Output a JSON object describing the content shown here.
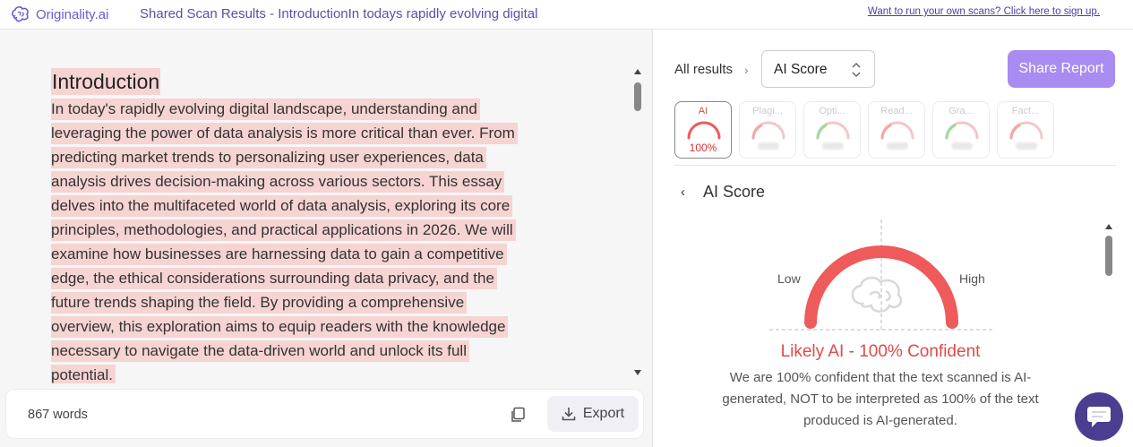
{
  "header": {
    "brand": "Originality.ai",
    "shared_title": "Shared Scan Results - IntroductionIn todays rapidly evolving digital",
    "signup_link": "Want to run your own scans? Click here to sign up."
  },
  "document": {
    "title": "Introduction",
    "lines": [
      "In today's rapidly evolving digital landscape, understanding and",
      "leveraging the power of data analysis is more critical than ever. From",
      "predicting market trends to personalizing user experiences, data",
      "analysis drives decision-making across various sectors. This essay",
      "delves into the multifaceted world of data analysis, exploring its core",
      "principles, methodologies, and practical applications in 2026. We will",
      "examine how businesses are harnessing data to gain a competitive",
      "edge, the ethical considerations surrounding data privacy, and the",
      "future trends shaping the field. By providing a comprehensive",
      "overview, this exploration aims to equip readers with the knowledge",
      "necessary to navigate the data-driven world and unlock its full",
      "potential."
    ],
    "highlight_color": "#f6d4d2"
  },
  "footer": {
    "word_count": "867 words",
    "export_label": "Export"
  },
  "results": {
    "breadcrumb": "All results",
    "select_value": "AI Score",
    "share_label": "Share Report",
    "tabs": [
      {
        "label": "AI",
        "score": "100%",
        "active": true
      },
      {
        "label": "Plagi...",
        "score": "",
        "active": false
      },
      {
        "label": "Opti...",
        "score": "",
        "active": false
      },
      {
        "label": "Read...",
        "score": "",
        "active": false
      },
      {
        "label": "Gra...",
        "score": "",
        "active": false
      },
      {
        "label": "Fact...",
        "score": "",
        "active": false
      }
    ],
    "section_title": "AI Score",
    "gauge_low": "Low",
    "gauge_high": "High",
    "ai_score_percent": 100,
    "verdict": "Likely AI - 100% Confident",
    "explanation": "We are 100% confident that the text scanned is AI-generated, NOT to be interpreted as 100% of the text produced is AI-generated."
  },
  "colors": {
    "accent": "#a88cf2",
    "danger": "#ef5a5a",
    "brand": "#6b59d3"
  }
}
